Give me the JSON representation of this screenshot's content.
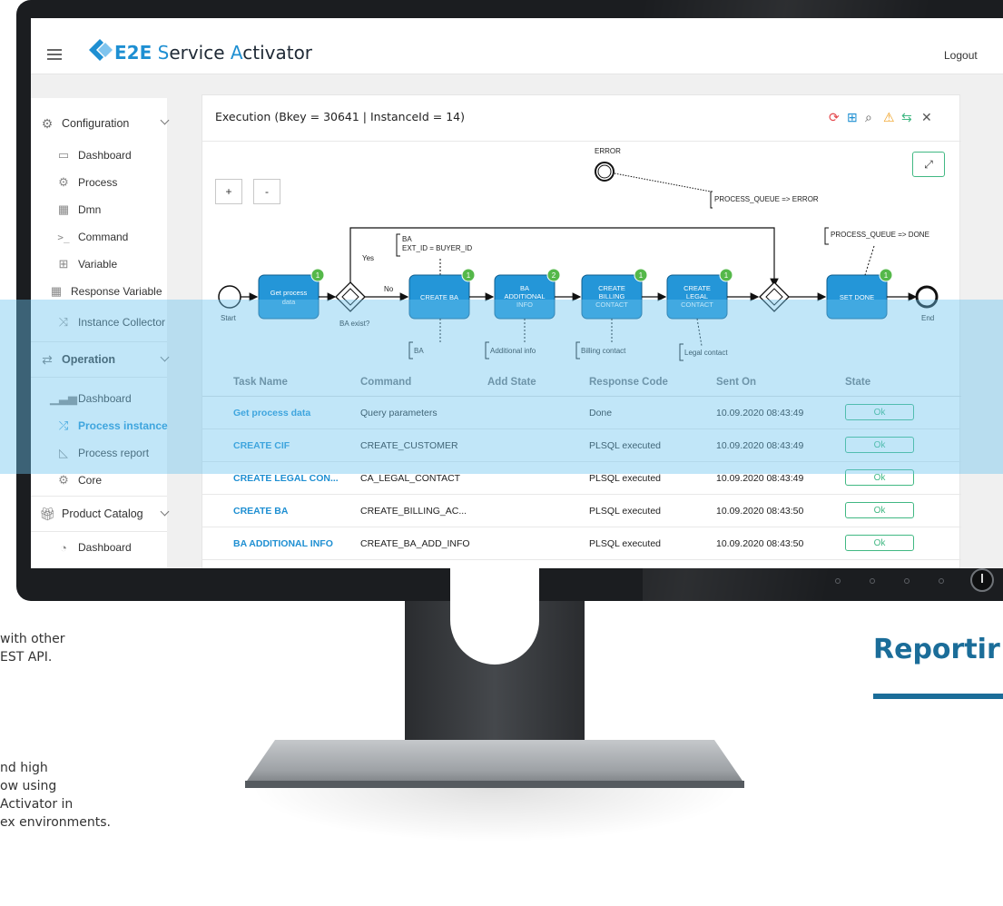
{
  "background": {
    "left_text_1": "with other\nEST API.",
    "left_text_2": "nd high\now using\nActivator in\nex environments.",
    "right_heading": "Reportir",
    "bottom_heading": "",
    "accent_color": "#1b6d99"
  },
  "app": {
    "logo_prefix": "E2E",
    "logo_word_1_first": "S",
    "logo_word_1_rest": "ervice ",
    "logo_word_2_first": "A",
    "logo_word_2_rest": "ctivator",
    "logout_label": "Logout",
    "brand_color": "#1e8fd2"
  },
  "sidebar": {
    "groups": [
      {
        "label": "Configuration",
        "icon": "gear-icon"
      },
      {
        "label": "Operation",
        "icon": "switch-icon"
      },
      {
        "label": "Product Catalog",
        "icon": "gift-icon"
      }
    ],
    "configuration_items": [
      {
        "label": "Dashboard",
        "icon": "monitor-icon"
      },
      {
        "label": "Process",
        "icon": "gears-icon"
      },
      {
        "label": "Dmn",
        "icon": "grid-icon"
      },
      {
        "label": "Command",
        "icon": "terminal-icon"
      },
      {
        "label": "Variable",
        "icon": "boxes-icon"
      },
      {
        "label": "Response Variable",
        "icon": "grid-icon"
      },
      {
        "label": "Instance Collector",
        "icon": "merge-icon"
      }
    ],
    "operation_items": [
      {
        "label": "Dashboard",
        "icon": "chart-icon"
      },
      {
        "label": "Process instance",
        "icon": "shuffle-icon",
        "active": true
      },
      {
        "label": "Process report",
        "icon": "area-chart-icon"
      },
      {
        "label": "Core",
        "icon": "gear-icon"
      }
    ],
    "product_items": [
      {
        "label": "Dashboard",
        "icon": "speedometer-icon"
      }
    ]
  },
  "card": {
    "title": "Execution (Bkey = 30641 | InstanceId = 14)",
    "header_icons": [
      "refresh-icon",
      "grid-icon",
      "search-icon",
      "warning-icon",
      "sync-icon",
      "close-icon"
    ],
    "zoom_in_label": "+",
    "zoom_out_label": "-",
    "expand_icon": "expand-icon"
  },
  "diagram": {
    "start_label": "Start",
    "end_label": "End",
    "error_label": "ERROR",
    "gateway_label": "BA exist?",
    "yes_label": "Yes",
    "no_label": "No",
    "error_annotation": "PROCESS_QUEUE => ERROR",
    "done_annotation": "PROCESS_QUEUE => DONE",
    "ba_annotation_1": "BA",
    "ba_annotation_2": "EXT_ID = BUYER_ID",
    "tasks": [
      {
        "label_1": "Get process",
        "label_2": "data",
        "label_3": "",
        "badge": "1"
      },
      {
        "label_1": "CREATE BA",
        "label_2": "",
        "label_3": "",
        "badge": "1"
      },
      {
        "label_1": "BA",
        "label_2": "ADDITIONAL",
        "label_3": "INFO",
        "badge": "2"
      },
      {
        "label_1": "CREATE",
        "label_2": "BILLING",
        "label_3": "CONTACT",
        "badge": "1"
      },
      {
        "label_1": "CREATE",
        "label_2": "LEGAL",
        "label_3": "CONTACT",
        "badge": "1"
      },
      {
        "label_1": "SET DONE",
        "label_2": "",
        "label_3": "",
        "badge": "1"
      }
    ],
    "data_objects": [
      "BA",
      "Additional info",
      "Billing contact",
      "Legal contact"
    ]
  },
  "table": {
    "headers": {
      "task_name": "Task Name",
      "command": "Command",
      "add_state": "Add State",
      "response_code": "Response Code",
      "sent_on": "Sent On",
      "state": "State"
    },
    "rows": [
      {
        "task_name": "Get process data",
        "command": "Query parameters",
        "add_state": "",
        "response_code": "Done",
        "sent_on": "10.09.2020 08:43:49",
        "state": "Ok"
      },
      {
        "task_name": "CREATE CIF",
        "command": "CREATE_CUSTOMER",
        "add_state": "",
        "response_code": "PLSQL executed",
        "sent_on": "10.09.2020 08:43:49",
        "state": "Ok"
      },
      {
        "task_name": "CREATE LEGAL CON...",
        "command": "CA_LEGAL_CONTACT",
        "add_state": "",
        "response_code": "PLSQL executed",
        "sent_on": "10.09.2020 08:43:49",
        "state": "Ok"
      },
      {
        "task_name": "CREATE BA",
        "command": "CREATE_BILLING_AC...",
        "add_state": "",
        "response_code": "PLSQL executed",
        "sent_on": "10.09.2020 08:43:50",
        "state": "Ok"
      },
      {
        "task_name": "BA ADDITIONAL INFO",
        "command": "CREATE_BA_ADD_INFO",
        "add_state": "",
        "response_code": "PLSQL executed",
        "sent_on": "10.09.2020 08:43:50",
        "state": "Ok"
      }
    ],
    "ok_color": "#41b883"
  }
}
